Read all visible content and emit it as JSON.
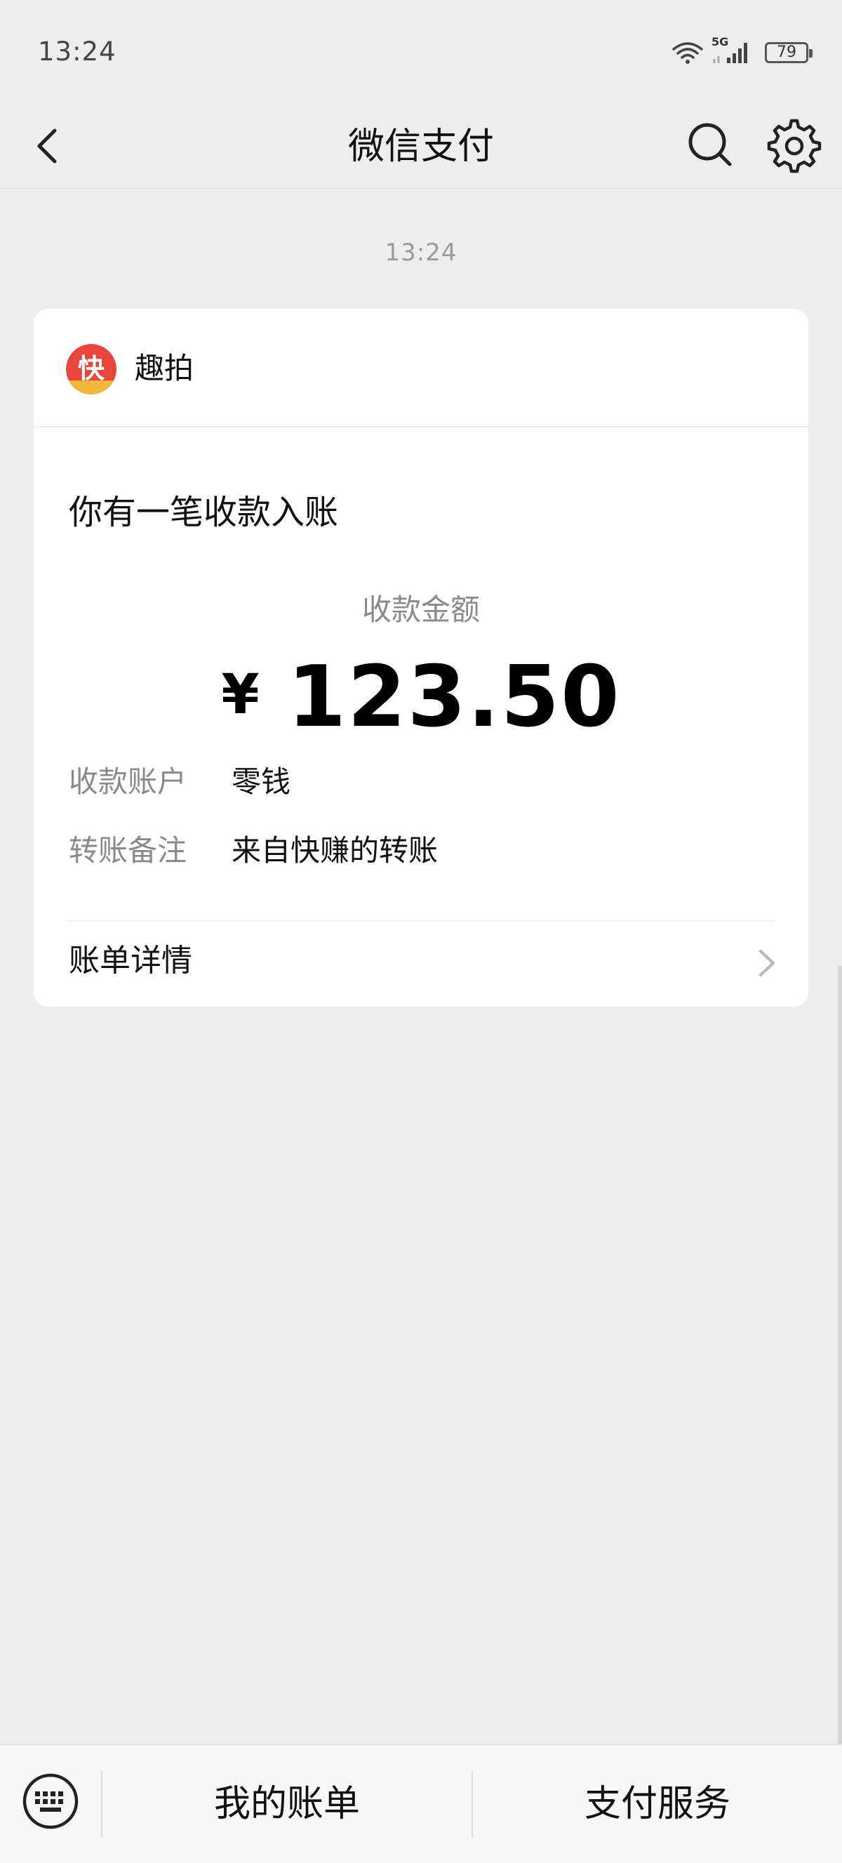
{
  "status_bar": {
    "time": "13:24",
    "network": "5G",
    "battery": "79"
  },
  "nav": {
    "title": "微信支付"
  },
  "message_time": "13:24",
  "card": {
    "merchant_name": "趣拍",
    "merchant_logo_char": "快",
    "heading": "你有一笔收款入账",
    "amount_label": "收款金额",
    "amount_currency": "¥",
    "amount_value": "123.50",
    "rows": [
      {
        "label": "收款账户",
        "value": "零钱"
      },
      {
        "label": "转账备注",
        "value": "来自快赚的转账"
      }
    ],
    "detail_label": "账单详情"
  },
  "bottom_bar": {
    "items": [
      {
        "label": "我的账单"
      },
      {
        "label": "支付服务"
      }
    ]
  },
  "colors": {
    "background": "#ededed",
    "card": "#ffffff",
    "logo_red": "#e8463c",
    "logo_gold": "#f0b73a"
  }
}
